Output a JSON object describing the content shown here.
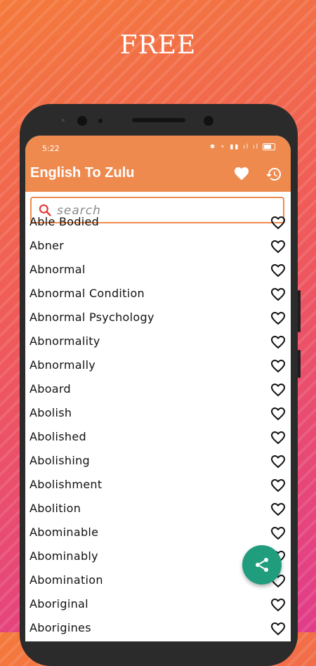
{
  "promo": {
    "title": "FREE"
  },
  "status_bar": {
    "time": "5:22",
    "icons": "✱ ⚬ ▮▮ ıl ıl"
  },
  "app": {
    "title": "English To Zulu"
  },
  "search": {
    "placeholder": "search",
    "value": ""
  },
  "words": [
    "Able Bodied",
    "Abner",
    "Abnormal",
    "Abnormal Condition",
    "Abnormal Psychology",
    "Abnormality",
    "Abnormally",
    "Aboard",
    "Abolish",
    "Abolished",
    "Abolishing",
    "Abolishment",
    "Abolition",
    "Abominable",
    "Abominably",
    "Abomination",
    "Aboriginal",
    "Aborigines"
  ],
  "colors": {
    "appbar": "#ee8a4e",
    "fab": "#1f9d7c"
  },
  "icons": {
    "favorites": "heart-icon",
    "history": "history-icon",
    "share": "share-icon",
    "search": "search-icon"
  }
}
